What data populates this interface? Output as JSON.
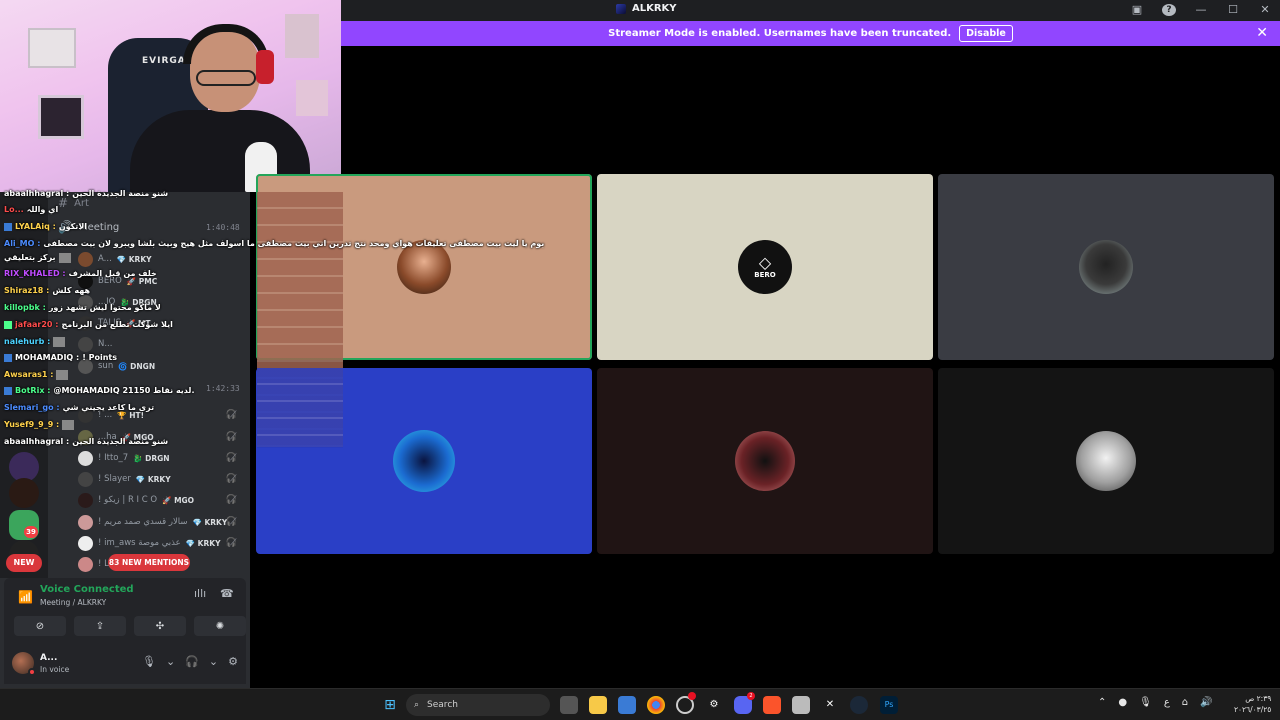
{
  "window": {
    "title": "ALKRKY",
    "controls": [
      "screen-icon",
      "help-icon",
      "minimize-icon",
      "maximize-icon",
      "close-icon"
    ]
  },
  "banner": {
    "text": "Streamer Mode is enabled. Usernames have been truncated.",
    "disable_label": "Disable",
    "color": "#9146ff"
  },
  "webcam": {
    "chair_brand": "EVIRGA"
  },
  "channels": [
    {
      "hash": "#",
      "name": "Art",
      "time": ""
    },
    {
      "hash": "🔊",
      "name": "Meeting",
      "time": "1:40:48"
    },
    {
      "hash": "",
      "name": "",
      "time": "1:42:33"
    }
  ],
  "members": [
    {
      "name": "A...",
      "tag": "KRKY",
      "tag_icon": "💎",
      "color": "#7a4a2e"
    },
    {
      "name": "BERO",
      "tag": "PMC",
      "tag_icon": "🚀",
      "color": "#101010"
    },
    {
      "name": "...IQ",
      "tag": "DRGN",
      "tag_icon": "🐉",
      "color": "#505050"
    },
    {
      "name": "TALIS",
      "tag": "MT",
      "tag_icon": "🚀",
      "color": "#2f2f2f"
    },
    {
      "name": "N...",
      "tag": "",
      "tag_icon": "",
      "color": "#444"
    },
    {
      "name": "sun",
      "tag": "DNGN",
      "tag_icon": "🌀",
      "color": "#555"
    },
    {
      "name": "! ...",
      "tag": "HT!",
      "tag_icon": "🏆",
      "color": "#333"
    },
    {
      "name": "...ha",
      "tag": "MGO",
      "tag_icon": "🚀",
      "color": "#664"
    },
    {
      "name": "! Itto_7",
      "tag": "DRGN",
      "tag_icon": "🐉",
      "color": "#ddd"
    },
    {
      "name": "! Slayer",
      "tag": "KRKY",
      "tag_icon": "💎",
      "color": "#444"
    },
    {
      "name": "! زيكو | R I C O",
      "tag": "MGO",
      "tag_icon": "🚀",
      "color": "#2a1a1a"
    },
    {
      "name": "! سالار قسدي صمد مريم",
      "tag": "KRKY",
      "tag_icon": "💎",
      "color": "#cc9999"
    },
    {
      "name": "! im_aws عذبي موصة",
      "tag": "KRKY",
      "tag_icon": "💎",
      "color": "#eee"
    },
    {
      "name": "! L...",
      "tag": "",
      "tag_icon": "",
      "color": "#c88"
    }
  ],
  "mentions_label": "83 NEW MENTIONS",
  "new_label": "NEW",
  "rail_badge": "39",
  "voice": {
    "status": "Voice Connected",
    "channel": "Meeting / ALKRKY",
    "buttons": [
      "camera-off-icon",
      "screen-share-icon",
      "activities-icon",
      "soundboard-icon"
    ]
  },
  "user": {
    "name": "A...",
    "status": "In voice"
  },
  "chat": [
    {
      "user": "abaalhhagral :",
      "user_color": "#ffffff",
      "msg": "شنو منصة الجديدة الحين"
    },
    {
      "user": "Lo...",
      "user_color": "#ff4c4c",
      "msg": "اي واللہ"
    },
    {
      "user": "LYALAiq :",
      "user_color": "#ffd24c",
      "msg": "الاتكون"
    },
    {
      "user": "Ali_MO :",
      "user_color": "#4c8cff",
      "msg": "بوم يا ليت بيت مصطفى تعليقات هواي ومحد نتج تدرين اني بيت مصطفى ما اسولف مثل هيج وبيث بلشا ويبرو لان بيت مصطفى"
    },
    {
      "user": "",
      "user_color": "#ffffff",
      "msg": "بركز بتعليقي"
    },
    {
      "user": "RIX_KHALED :",
      "user_color": "#c04cff",
      "msg": "خلف من قبل المشرف"
    },
    {
      "user": "Shiraz18 :",
      "user_color": "#ffd24c",
      "msg": "ههه كلش"
    },
    {
      "user": "killopbk :",
      "user_color": "#4cff8c",
      "msg": "لا ماكو محتوا ليش تشهد زور"
    },
    {
      "user": "jafaar20 :",
      "user_color": "#ff4c4c",
      "msg": "ايلا شوكت تطلع من البرنامج"
    },
    {
      "user": "nalehurb :",
      "user_color": "#4cd2ff",
      "msg": ""
    },
    {
      "user": "MOHAMADIQ :",
      "user_color": "#ffffff",
      "msg": "! Points"
    },
    {
      "user": "Awsaras1 :",
      "user_color": "#ffd24c",
      "msg": ""
    },
    {
      "user": "BotRix :",
      "user_color": "#4cff8c",
      "msg": "@MOHAMADIQ 21150 لديه نقاط."
    },
    {
      "user": "Slemari_go :",
      "user_color": "#4c8cff",
      "msg": "ترى ما كاعد يجيني شي"
    },
    {
      "user": "Yusef9_9_9 :",
      "user_color": "#ffd24c",
      "msg": ""
    },
    {
      "user": "abaalhhagral :",
      "user_color": "#ffffff",
      "msg": "شنو منصة الجديدة الحين"
    }
  ],
  "tiles": [
    {
      "bg": "#c99a7e",
      "avatar": "avatar-person",
      "active": true,
      "label": ""
    },
    {
      "bg": "#d8d5c3",
      "avatar": "avatar-bero-logo",
      "active": false,
      "label": "BERO"
    },
    {
      "bg": "#3a3c43",
      "avatar": "avatar-hooded",
      "active": false,
      "label": ""
    },
    {
      "bg": "#2a3fc6",
      "avatar": "avatar-anime-blue",
      "active": false,
      "label": ""
    },
    {
      "bg": "#201414",
      "avatar": "avatar-demon-mask",
      "active": false,
      "label": ""
    },
    {
      "bg": "#141414",
      "avatar": "avatar-anime-girl",
      "active": false,
      "label": ""
    }
  ],
  "taskbar": {
    "search_placeholder": "Search",
    "apps": [
      "windows-icon",
      "task-view-icon",
      "file-explorer-icon",
      "store-icon",
      "chrome-icon",
      "steelseries-icon",
      "settings-icon",
      "discord-icon",
      "brave-icon",
      "notepad-icon",
      "capcut-icon",
      "steam-icon",
      "photoshop-icon"
    ],
    "discord_badge": "2",
    "clock_time": "٢:٣٩ ص",
    "clock_date": "٢٠٢٦/٠٣/٢٥",
    "lang": "ع"
  }
}
